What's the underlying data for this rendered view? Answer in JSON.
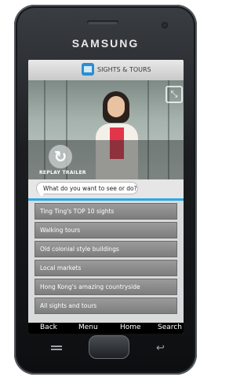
{
  "device": {
    "brand": "SAMSUNG"
  },
  "app": {
    "title": "SIGHTS & TOURS",
    "replay_label": "REPLAY TRAILER",
    "prompt": "What do you want to see or do?"
  },
  "menu": {
    "items": [
      {
        "label": "Ting Ting's TOP 10 sights"
      },
      {
        "label": "Walking tours"
      },
      {
        "label": "Old colonial style buildings"
      },
      {
        "label": "Local markets"
      },
      {
        "label": "Hong Kong's amazing countryside"
      },
      {
        "label": "All sights and tours"
      }
    ]
  },
  "softkeys": {
    "back": "Back",
    "menu": "Menu",
    "home": "Home",
    "search": "Search"
  },
  "icons": {
    "replay": "replay-icon",
    "expand": "expand-icon",
    "app": "app-logo-icon",
    "hw_menu": "hardware-menu-icon",
    "hw_back": "hardware-back-icon"
  },
  "colors": {
    "accent_line": "#2aa9e4",
    "menu_item": "#8a8a8a"
  }
}
